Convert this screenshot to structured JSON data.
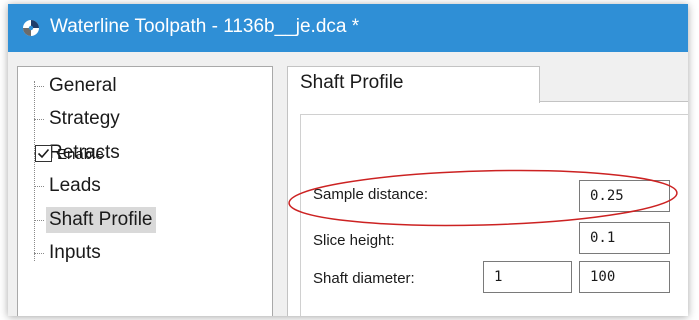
{
  "window": {
    "title": "Waterline Toolpath - 1136b__je.dca *",
    "accent_color": "#2f8fd6",
    "icon": "app-logo-icon"
  },
  "tree": {
    "items": [
      {
        "label": "General",
        "selected": false
      },
      {
        "label": "Strategy",
        "selected": false
      },
      {
        "label": "Retracts",
        "selected": false
      },
      {
        "label": "Leads",
        "selected": false
      },
      {
        "label": "Shaft Profile",
        "selected": true
      },
      {
        "label": "Inputs",
        "selected": false
      }
    ]
  },
  "tab": {
    "label": "Shaft Profile"
  },
  "form": {
    "enable": {
      "label": "Enable",
      "checked": true
    },
    "sample_distance": {
      "label": "Sample distance:",
      "value": "0.25"
    },
    "slice_height": {
      "label": "Slice height:",
      "value": "0.1"
    },
    "shaft_diameter": {
      "label": "Shaft diameter:",
      "value1": "1",
      "value2": "100"
    }
  },
  "annotation": {
    "color": "#cc2222"
  }
}
